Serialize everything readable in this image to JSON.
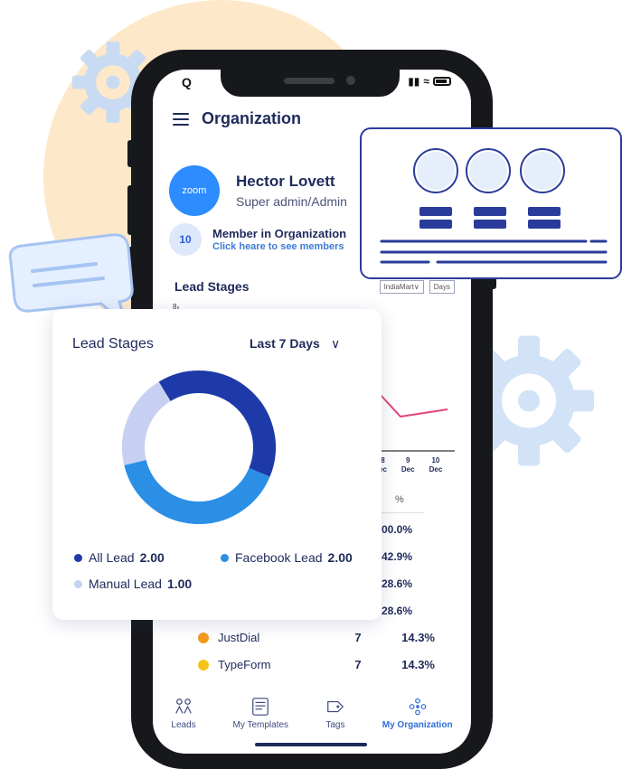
{
  "colors": {
    "accent": "#2f6fd8",
    "navy": "#1e2a5a",
    "dark_blue": "#1e3aa8",
    "light_blue": "#2b8fe6",
    "lavender": "#b7c2ef",
    "peach": "#fde9c9"
  },
  "status_bar": {
    "left": "Q"
  },
  "header": {
    "title": "Organization"
  },
  "profile": {
    "logo_text": "zoom",
    "name": "Hector Lovett",
    "role": "Super admin/Admin"
  },
  "members": {
    "count": "10",
    "title": "Member in Organization",
    "link": "Click heare to see members"
  },
  "lead_stages_bg": {
    "title": "Lead Stages",
    "source_select": "IndiaMart∨",
    "range_select": "Days",
    "y_tick": "8"
  },
  "x_ticks": [
    {
      "day": "8",
      "month": "ec"
    },
    {
      "day": "9",
      "month": "Dec"
    },
    {
      "day": "10",
      "month": "Dec"
    }
  ],
  "table": {
    "pct_header": "%",
    "hidden_pcts": [
      "00.0%",
      "42.9%",
      "28.6%",
      "28.6%"
    ],
    "rows": [
      {
        "name": "JustDial",
        "count": "7",
        "pct": "14.3%",
        "color": "#f29a1e"
      },
      {
        "name": "TypeForm",
        "count": "7",
        "pct": "14.3%",
        "color": "#f6c31b"
      }
    ]
  },
  "tabs": [
    {
      "label": "Leads",
      "icon": "leads-icon",
      "active": false
    },
    {
      "label": "My Templates",
      "icon": "templates-icon",
      "active": false
    },
    {
      "label": "Tags",
      "icon": "tag-icon",
      "active": false
    },
    {
      "label": "My Organization",
      "icon": "organization-icon",
      "active": true
    }
  ],
  "donut_card": {
    "title": "Lead Stages",
    "range": "Last 7 Days",
    "legend": [
      {
        "label": "All Lead",
        "value": "2.00",
        "color": "#1e3aa8"
      },
      {
        "label": "Facebook Lead",
        "value": "2.00",
        "color": "#2b8fe6"
      },
      {
        "label": "Manual Lead",
        "value": "1.00",
        "color": "#c7d0f3"
      }
    ]
  },
  "chart_data": {
    "type": "pie",
    "categories": [
      "All Lead",
      "Facebook Lead",
      "Manual Lead"
    ],
    "values": [
      2.0,
      2.0,
      1.0
    ],
    "title": "Lead Stages"
  }
}
